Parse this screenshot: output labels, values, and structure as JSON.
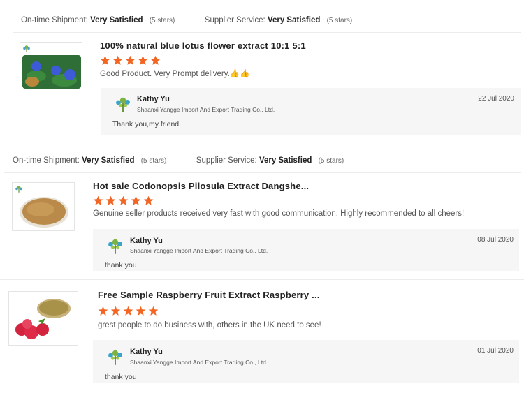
{
  "reviews": [
    {
      "ratings": {
        "shipment_label": "On-time Shipment:",
        "shipment_value": "Very Satisfied",
        "shipment_stars": "(5 stars)",
        "supplier_label": "Supplier Service:",
        "supplier_value": "Very Satisfied",
        "supplier_stars": "(5 stars)"
      },
      "product_title": "100% natural blue lotus flower extract 10:1 5:1",
      "star_rating": 5,
      "comment": "Good Product. Very Prompt delivery.👍👍",
      "reply": {
        "name": "Kathy Yu",
        "company": "Shaanxi Yangge Import And Export Trading Co., Ltd.",
        "date": "22 Jul 2020",
        "text": "Thank you,my friend"
      }
    },
    {
      "ratings": {
        "shipment_label": "On-time Shipment:",
        "shipment_value": "Very Satisfied",
        "shipment_stars": "(5 stars)",
        "supplier_label": "Supplier Service:",
        "supplier_value": "Very Satisfied",
        "supplier_stars": "(5 stars)"
      },
      "product_title": "Hot sale Codonopsis Pilosula Extract Dangshe...",
      "star_rating": 5,
      "comment": "Genuine seller products received very fast with good communication. Highly recommended to all cheers!",
      "reply": {
        "name": "Kathy Yu",
        "company": "Shaanxi Yangge Import And Export Trading Co., Ltd.",
        "date": "08 Jul 2020",
        "text": "thank you"
      }
    },
    {
      "product_title": "Free Sample Raspberry Fruit Extract Raspberry ...",
      "star_rating": 5,
      "comment": "grest people to do business with, others in the UK need to see!",
      "reply": {
        "name": "Kathy Yu",
        "company": "Shaanxi Yangge Import And Export Trading Co., Ltd.",
        "date": "01 Jul 2020",
        "text": "thank you"
      }
    }
  ],
  "colors": {
    "star": "#f26522",
    "reply_bg": "#f6f6f6",
    "divider": "#ececec"
  },
  "icons": {
    "star": "star-icon",
    "logo": "tree-logo-icon"
  }
}
